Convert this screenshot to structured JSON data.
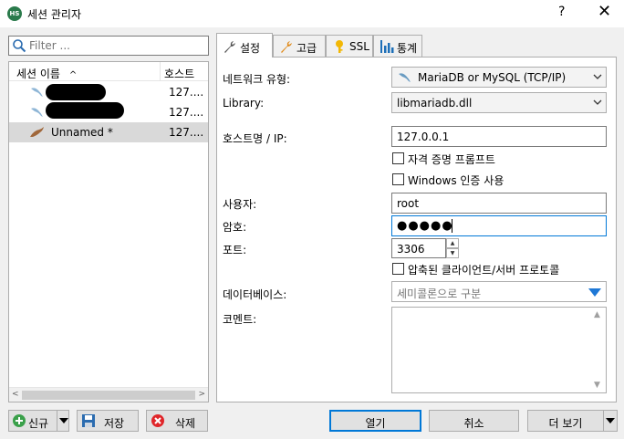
{
  "window": {
    "icon_text": "HS",
    "title": "세션 관리자",
    "help": "?",
    "close": "✕"
  },
  "filter": {
    "placeholder": "Filter ..."
  },
  "session_list": {
    "columns": {
      "name": "세션 이름",
      "sort_indicator": "^",
      "host": "호스트"
    },
    "rows": [
      {
        "name": "",
        "host": "127...."
      },
      {
        "name": "",
        "host": "127...."
      },
      {
        "name": "Unnamed *",
        "host": "127...."
      }
    ],
    "scroll_left": "<",
    "scroll_right": ">"
  },
  "tabs": [
    {
      "label": "설정",
      "icon": "wrench-icon"
    },
    {
      "label": "고급",
      "icon": "wrench-orange-icon"
    },
    {
      "label": "SSL",
      "icon": "key-icon"
    },
    {
      "label": "통계",
      "icon": "bar-chart-icon"
    }
  ],
  "settings": {
    "network_type_label": "네트워크 유형:",
    "network_type_value": "MariaDB or MySQL (TCP/IP)",
    "library_label": "Library:",
    "library_value": "libmariadb.dll",
    "host_label": "호스트명 / IP:",
    "host_value": "127.0.0.1",
    "credential_prompt_label": "자격 증명 프롬프트",
    "windows_auth_label": "Windows 인증 사용",
    "user_label": "사용자:",
    "user_value": "root",
    "password_label": "암호:",
    "password_value": "●●●●●",
    "port_label": "포트:",
    "port_value": "3306",
    "compression_label": "압축된 클라이언트/서버 프로토콜",
    "databases_label": "데이터베이스:",
    "databases_placeholder": "세미콜론으로 구분",
    "comment_label": "코멘트:",
    "comment_scroll_up": "▲",
    "comment_scroll_down": "▼"
  },
  "buttons": {
    "new": "신규",
    "save": "저장",
    "delete": "삭제",
    "open": "열기",
    "cancel": "취소",
    "more": "더 보기"
  },
  "colors": {
    "accent": "#0078d7",
    "selection": "#d9d9d9",
    "add_green": "#3aa04a",
    "delete_red": "#e0262a"
  }
}
